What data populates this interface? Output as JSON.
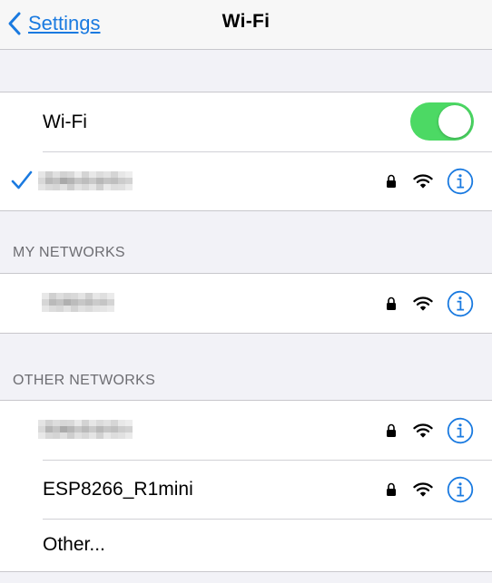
{
  "navbar": {
    "back_label": "Settings",
    "title": "Wi-Fi"
  },
  "wifi_group": {
    "toggle_label": "Wi-Fi",
    "toggle_on": true,
    "connected_network": {
      "name_redacted": true,
      "secured": true,
      "signal_bars": 3
    }
  },
  "my_networks": {
    "header": "MY NETWORKS",
    "networks": [
      {
        "name_redacted": true,
        "secured": true,
        "signal_bars": 3
      }
    ]
  },
  "other_networks": {
    "header": "OTHER NETWORKS",
    "networks": [
      {
        "name_redacted": true,
        "secured": true,
        "signal_bars": 3
      },
      {
        "name": "ESP8266_R1mini",
        "secured": true,
        "signal_bars": 3
      }
    ],
    "other_label": "Other..."
  },
  "icons": {
    "back": "chevron-left-icon",
    "check": "checkmark-icon",
    "lock": "lock-icon",
    "wifi": "wifi-signal-icon",
    "info": "info-icon"
  },
  "colors": {
    "accent": "#1a7ae0",
    "toggle_on": "#4cd964",
    "background": "#f2f2f7",
    "header_text": "#6d6d72"
  }
}
